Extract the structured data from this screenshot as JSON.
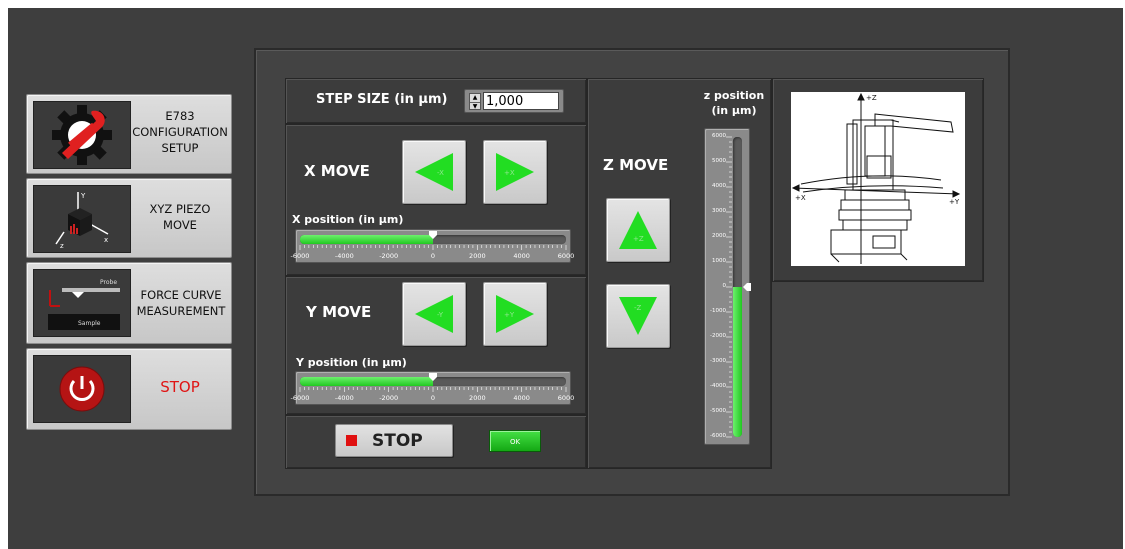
{
  "sidebar": {
    "items": [
      {
        "label": "E783 CONFIGURATION SETUP",
        "icon": "gear-wrench-prohibited-icon"
      },
      {
        "label": "XYZ PIEZO MOVE",
        "icon": "xyz-axes-icon"
      },
      {
        "label": "FORCE CURVE MEASUREMENT",
        "icon": "probe-sample-icon",
        "probe_text": "Probe",
        "sample_text": "Sample"
      },
      {
        "label": "STOP",
        "icon": "power-icon"
      }
    ]
  },
  "step": {
    "label": "STEP SIZE (in µm)",
    "value": "1,000"
  },
  "x_move": {
    "title": "X MOVE",
    "left_label": "-X",
    "right_label": "+X",
    "slider_label": "X position (in µm)",
    "value": 0,
    "ticks": [
      "-6000",
      "-4000",
      "-2000",
      "0",
      "2000",
      "4000",
      "6000"
    ]
  },
  "y_move": {
    "title": "Y MOVE",
    "left_label": "-Y",
    "right_label": "+Y",
    "slider_label": "Y position (in µm)",
    "value": 0,
    "ticks": [
      "-6000",
      "-4000",
      "-2000",
      "0",
      "2000",
      "4000",
      "6000"
    ]
  },
  "z_move": {
    "title": "Z MOVE",
    "up_label": "+Z",
    "down_label": "-Z",
    "gauge_label_1": "z position",
    "gauge_label_2": "(in µm)",
    "value": 0,
    "ticks": [
      "6000",
      "5000",
      "4000",
      "3000",
      "2000",
      "1000",
      "0",
      "-1000",
      "-2000",
      "-3000",
      "-4000",
      "-5000",
      "-6000"
    ]
  },
  "stop_button": {
    "label": "STOP",
    "color": "#e01010"
  },
  "ok_indicator": {
    "label": "OK",
    "color": "#22c322"
  },
  "diagram": {
    "z_label": "+Z",
    "x_label": "+X",
    "y_label": "+Y"
  },
  "colors": {
    "accent_green": "#22dd22",
    "stop_red": "#e01414",
    "background": "#3e3e3e"
  }
}
